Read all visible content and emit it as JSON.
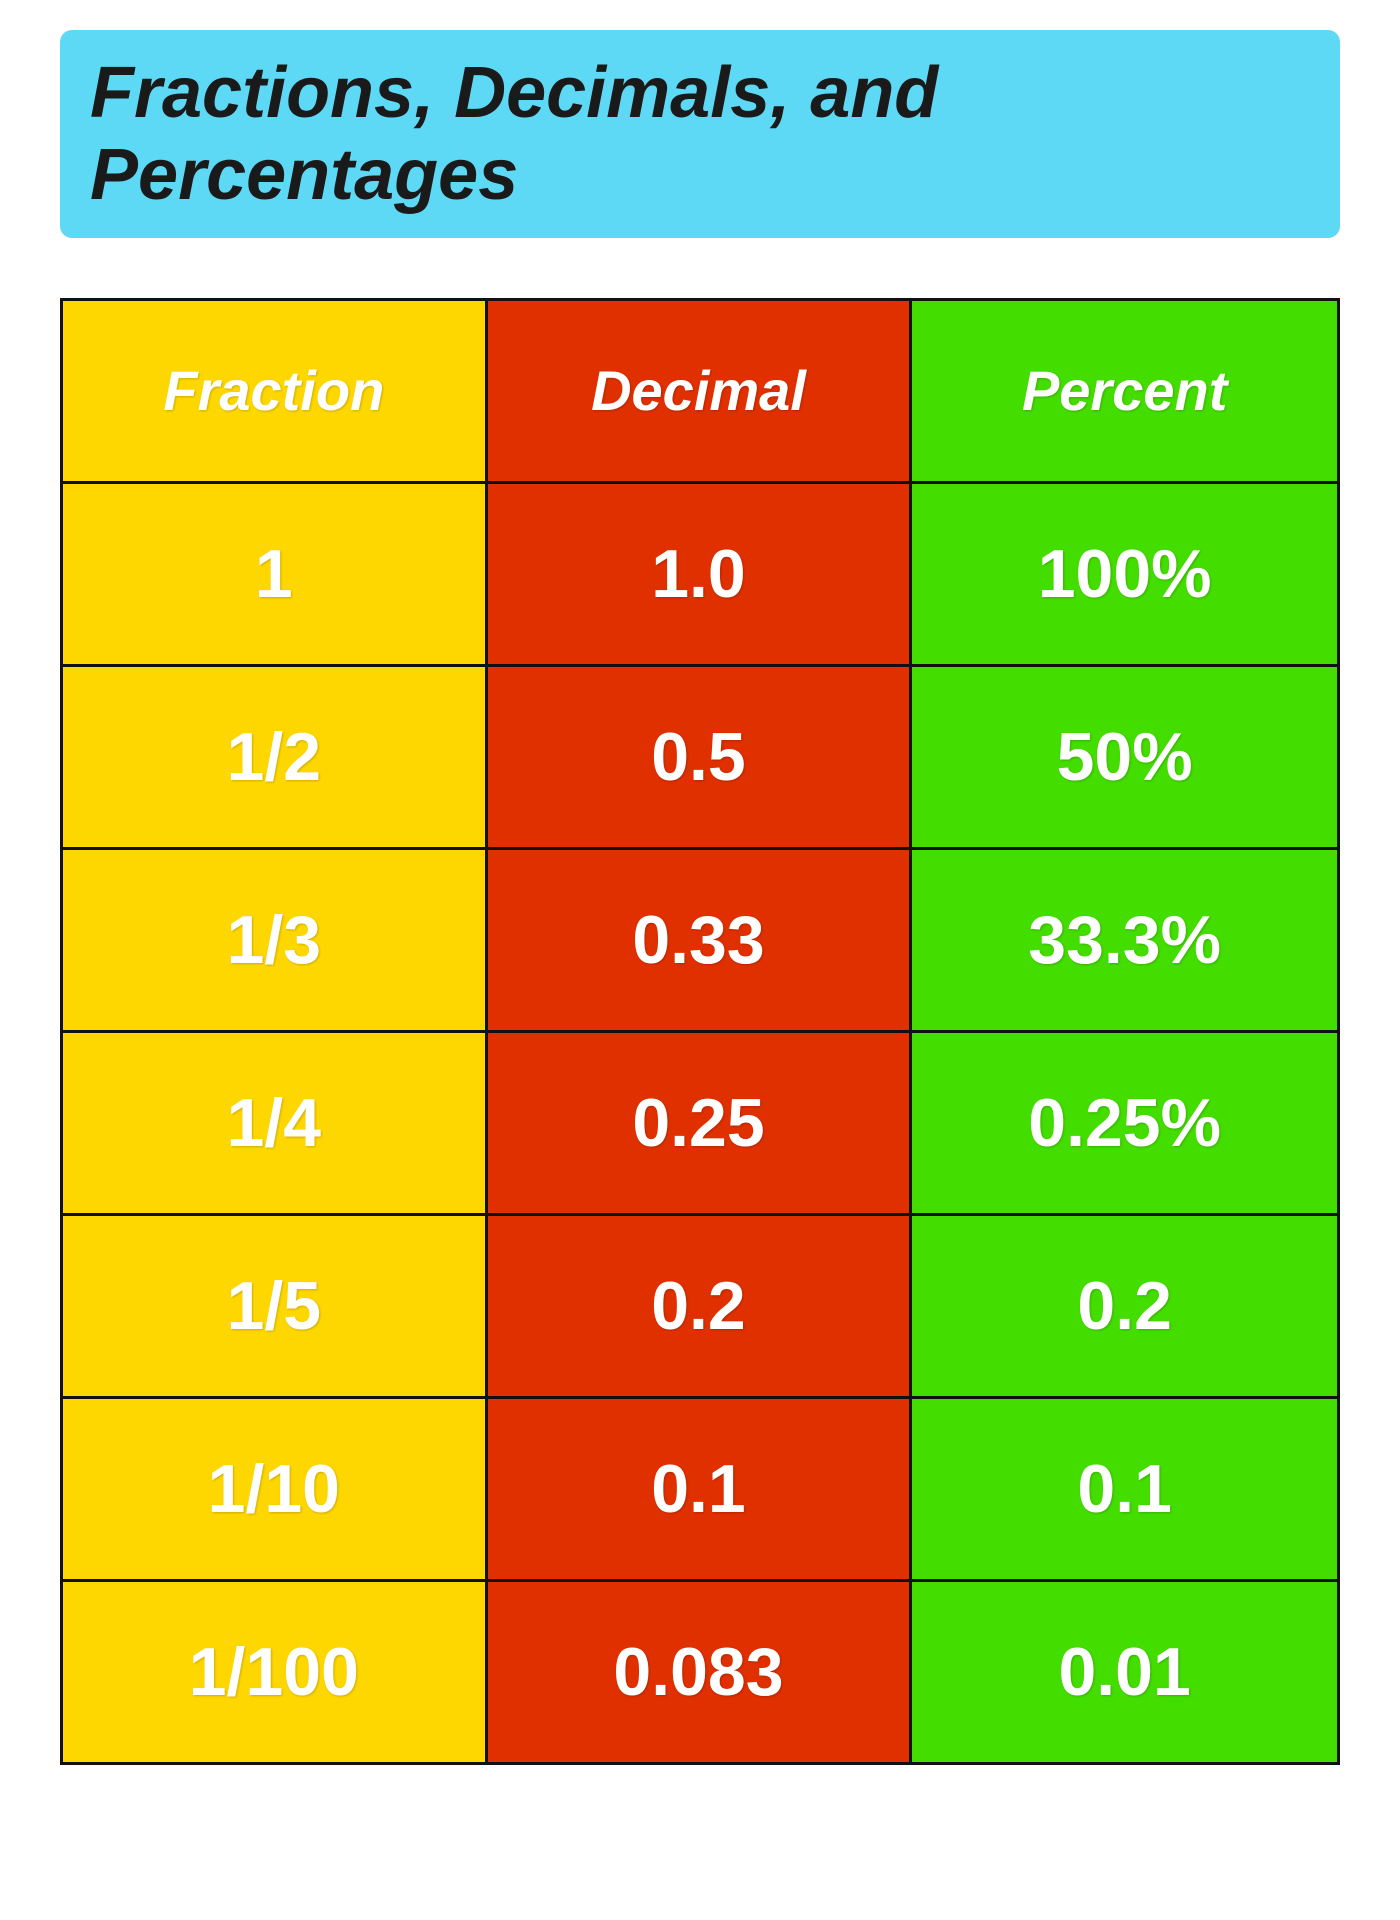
{
  "page": {
    "title": "Fractions, Decimals, and Percentages"
  },
  "table": {
    "headers": [
      {
        "label": "Fraction",
        "bg": "yellow"
      },
      {
        "label": "Decimal",
        "bg": "red"
      },
      {
        "label": "Percent",
        "bg": "green"
      }
    ],
    "rows": [
      {
        "fraction": "1",
        "decimal": "1.0",
        "percent": "100%"
      },
      {
        "fraction": "1/2",
        "decimal": "0.5",
        "percent": "50%"
      },
      {
        "fraction": "1/3",
        "decimal": "0.33",
        "percent": "33.3%"
      },
      {
        "fraction": "1/4",
        "decimal": "0.25",
        "percent": "0.25%"
      },
      {
        "fraction": "1/5",
        "decimal": "0.2",
        "percent": "0.2"
      },
      {
        "fraction": "1/10",
        "decimal": "0.1",
        "percent": "0.1"
      },
      {
        "fraction": "1/100",
        "decimal": "0.083",
        "percent": "0.01"
      }
    ]
  }
}
